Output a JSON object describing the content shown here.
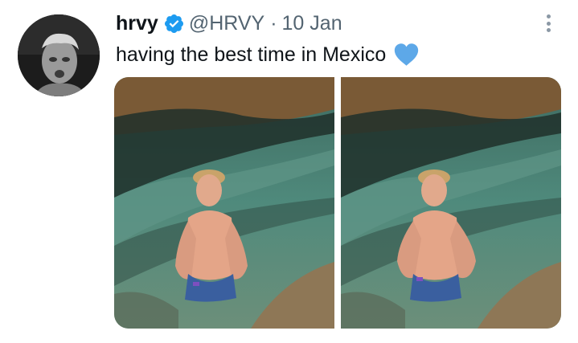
{
  "tweet": {
    "author_name": "hrvy",
    "handle": "@HRVY",
    "separator": "·",
    "date": "10 Jan",
    "text": "having the best time in Mexico",
    "verified_icon": "verified-badge-icon",
    "emoji": "blue-heart-icon",
    "accent_color": "#1d9bf0",
    "heart_color": "#5da8e8"
  },
  "media": {
    "photos": [
      {
        "id": "photo-1"
      },
      {
        "id": "photo-2"
      }
    ]
  }
}
